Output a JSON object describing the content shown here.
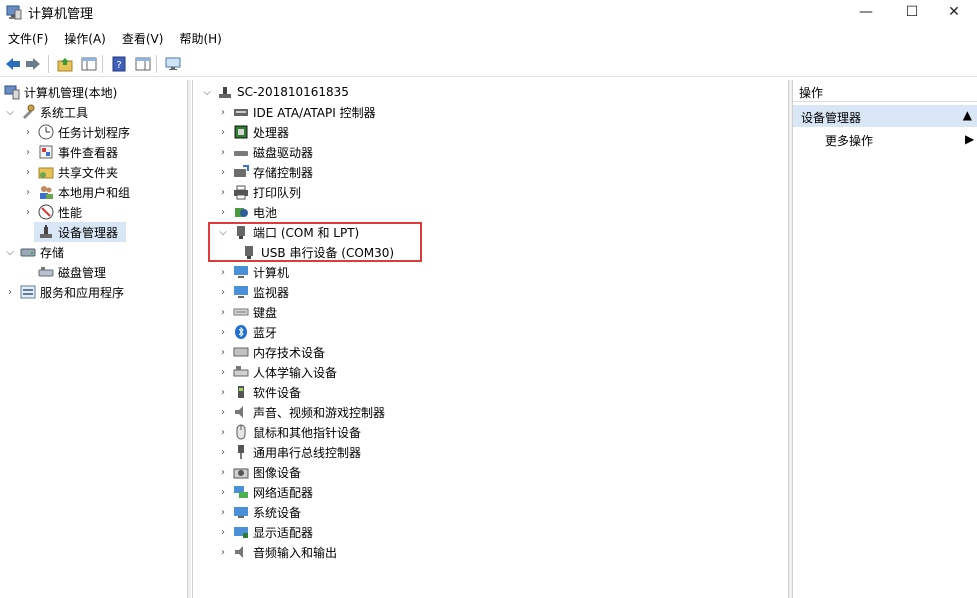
{
  "window": {
    "title": "计算机管理",
    "controls": {
      "minimize": "—",
      "maximize": "☐",
      "close": "✕"
    }
  },
  "menu": [
    "文件(F)",
    "操作(A)",
    "查看(V)",
    "帮助(H)"
  ],
  "left_tree": {
    "root": "计算机管理(本地)",
    "system_tools": "系统工具",
    "items": [
      "任务计划程序",
      "事件查看器",
      "共享文件夹",
      "本地用户和组",
      "性能",
      "设备管理器"
    ],
    "storage": "存储",
    "storage_items": [
      "磁盘管理"
    ],
    "services": "服务和应用程序"
  },
  "device_tree": {
    "computer": "SC-201810161835",
    "categories": [
      "IDE ATA/ATAPI 控制器",
      "处理器",
      "磁盘驱动器",
      "存储控制器",
      "打印队列",
      "电池",
      "端口 (COM 和 LPT)",
      "USB 串行设备 (COM30)",
      "计算机",
      "监视器",
      "键盘",
      "蓝牙",
      "内存技术设备",
      "人体学输入设备",
      "软件设备",
      "声音、视频和游戏控制器",
      "鼠标和其他指针设备",
      "通用串行总线控制器",
      "图像设备",
      "网络适配器",
      "系统设备",
      "显示适配器",
      "音频输入和输出"
    ]
  },
  "actions": {
    "header": "操作",
    "section": "设备管理器",
    "more": "更多操作"
  }
}
